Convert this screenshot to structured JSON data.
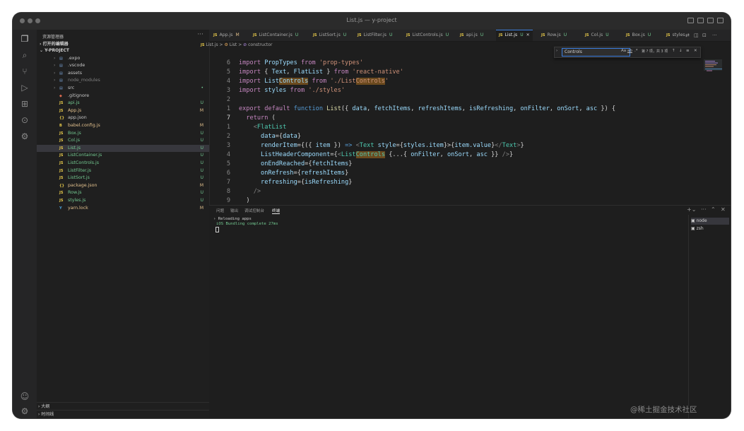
{
  "window": {
    "title": "List.js — y-project"
  },
  "sidebar": {
    "header": "资源管理器",
    "open_editors": "打开的编辑器",
    "project": "Y-PROJECT",
    "items": [
      {
        "name": ".expo",
        "type": "folder",
        "status": "",
        "status_color": "#9a9a9a",
        "color": "#c6c6c6"
      },
      {
        "name": ".vscode",
        "type": "folder",
        "status": "",
        "status_color": "#9a9a9a",
        "color": "#c6c6c6"
      },
      {
        "name": "assets",
        "type": "folder",
        "status": "",
        "status_color": "#9a9a9a",
        "color": "#c6c6c6"
      },
      {
        "name": "node_modules",
        "type": "folder",
        "status": "",
        "status_color": "#9a9a9a",
        "color": "#7f7f7f"
      },
      {
        "name": "src",
        "type": "folder",
        "status": "•",
        "status_color": "#73c991",
        "color": "#c6c6c6"
      },
      {
        "name": ".gitignore",
        "type": "git",
        "status": "",
        "status_color": "#9a9a9a",
        "color": "#c6c6c6"
      },
      {
        "name": "api.js",
        "type": "js",
        "status": "U",
        "status_color": "#73c991",
        "color": "#73c991"
      },
      {
        "name": "App.js",
        "type": "js",
        "status": "M",
        "status_color": "#e2c08d",
        "color": "#e2c08d"
      },
      {
        "name": "app.json",
        "type": "json",
        "status": "",
        "status_color": "#9a9a9a",
        "color": "#c6c6c6"
      },
      {
        "name": "babel.config.js",
        "type": "babel",
        "status": "M",
        "status_color": "#e2c08d",
        "color": "#e2c08d"
      },
      {
        "name": "Box.js",
        "type": "js",
        "status": "U",
        "status_color": "#73c991",
        "color": "#73c991"
      },
      {
        "name": "Col.js",
        "type": "js",
        "status": "U",
        "status_color": "#73c991",
        "color": "#73c991"
      },
      {
        "name": "List.js",
        "type": "js",
        "status": "U",
        "status_color": "#73c991",
        "color": "#73c991"
      },
      {
        "name": "ListContainer.js",
        "type": "js",
        "status": "U",
        "status_color": "#73c991",
        "color": "#73c991"
      },
      {
        "name": "ListControls.js",
        "type": "js",
        "status": "U",
        "status_color": "#73c991",
        "color": "#73c991"
      },
      {
        "name": "ListFilter.js",
        "type": "js",
        "status": "U",
        "status_color": "#73c991",
        "color": "#73c991"
      },
      {
        "name": "ListSort.js",
        "type": "js",
        "status": "U",
        "status_color": "#73c991",
        "color": "#73c991"
      },
      {
        "name": "package.json",
        "type": "json",
        "status": "M",
        "status_color": "#e2c08d",
        "color": "#e2c08d"
      },
      {
        "name": "Row.js",
        "type": "js",
        "status": "U",
        "status_color": "#73c991",
        "color": "#73c991"
      },
      {
        "name": "styles.js",
        "type": "js",
        "status": "U",
        "status_color": "#73c991",
        "color": "#73c991"
      },
      {
        "name": "yarn.lock",
        "type": "yarn",
        "status": "M",
        "status_color": "#e2c08d",
        "color": "#e2c08d"
      }
    ],
    "outline": "大纲",
    "timeline": "时间线"
  },
  "tabs": [
    {
      "label": "App.js",
      "status": "M",
      "active": false
    },
    {
      "label": "ListContainer.js",
      "status": "U",
      "active": false
    },
    {
      "label": "ListSort.js",
      "status": "U",
      "active": false
    },
    {
      "label": "ListFilter.js",
      "status": "U",
      "active": false
    },
    {
      "label": "ListControls.js",
      "status": "U",
      "active": false
    },
    {
      "label": "api.js",
      "status": "U",
      "active": false
    },
    {
      "label": "List.js",
      "status": "U",
      "active": true
    },
    {
      "label": "Row.js",
      "status": "U",
      "active": false
    },
    {
      "label": "Col.js",
      "status": "U",
      "active": false
    },
    {
      "label": "Box.js",
      "status": "U",
      "active": false
    },
    {
      "label": "styles",
      "status": "",
      "active": false
    }
  ],
  "breadcrumb": {
    "file": "List.js",
    "symbol": "List",
    "member": "constructor",
    "sep": ">"
  },
  "find": {
    "value": "Controls",
    "match_case": "Aa",
    "whole_word": "ab",
    "regex": ".*",
    "no_results": "第 ? 项，共 3 项"
  },
  "editor": {
    "line_numbers": [
      "6",
      "5",
      "4",
      "3",
      "2",
      "1",
      "7",
      "1",
      "2",
      "3",
      "4",
      "5",
      "6",
      "7",
      "8",
      "9"
    ]
  },
  "panel": {
    "tabs": [
      "问题",
      "输出",
      "调试控制台",
      "终端"
    ],
    "terminal_line1": "› Reloading apps",
    "terminal_line2": "iOS Bundling complete 27ms",
    "terminals": [
      "node",
      "zsh"
    ]
  },
  "watermark": "@稀土掘金技术社区"
}
